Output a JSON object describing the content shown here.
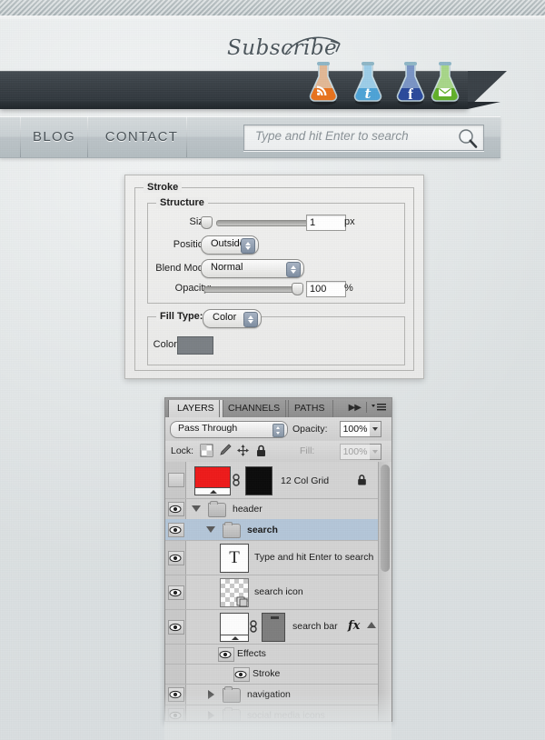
{
  "website": {
    "subscribe_label": "Subscribe",
    "social_icons": [
      {
        "name": "rss-flask-icon",
        "label": "RSS",
        "color": "#e8731e"
      },
      {
        "name": "twitter-flask-icon",
        "label": "Twitter",
        "color": "#4ea3d6"
      },
      {
        "name": "facebook-flask-icon",
        "label": "Facebook",
        "color": "#2b4a9b"
      },
      {
        "name": "email-flask-icon",
        "label": "Email",
        "color": "#62b02a"
      }
    ],
    "nav_items": [
      {
        "label": "BLOG"
      },
      {
        "label": "CONTACT"
      }
    ],
    "search": {
      "placeholder": "Type and hit Enter to search",
      "value": "",
      "icon": "magnifier-icon"
    }
  },
  "stroke_dialog": {
    "group_title": "Stroke",
    "structure": {
      "title": "Structure",
      "size_label": "Size:",
      "size_value": "1",
      "size_unit": "px",
      "position_label": "Position:",
      "position_value": "Outside",
      "blend_label": "Blend Mode:",
      "blend_value": "Normal",
      "opacity_label": "Opacity:",
      "opacity_value": "100",
      "opacity_unit": "%"
    },
    "fill": {
      "fill_type_label": "Fill Type:",
      "fill_type_value": "Color",
      "color_label": "Color:",
      "color_swatch": "#7b8085"
    }
  },
  "layers_panel": {
    "tabs": [
      {
        "label": "LAYERS",
        "active": true
      },
      {
        "label": "CHANNELS",
        "active": false
      },
      {
        "label": "PATHS",
        "active": false
      }
    ],
    "collapse_icon": "double-arrow-icon",
    "menu_icon": "panel-menu-icon",
    "blend_mode": "Pass Through",
    "opacity_label": "Opacity:",
    "opacity_value": "100%",
    "lock_label": "Lock:",
    "lock_icons": [
      "transparency-lock-icon",
      "brush-lock-icon",
      "move-lock-icon",
      "all-lock-icon"
    ],
    "fill_label": "Fill:",
    "fill_value": "100%",
    "rows": [
      {
        "name": "12 Col Grid",
        "type": "layer",
        "visible": false,
        "locked": true,
        "selected": false,
        "indent": 0,
        "dim": false
      },
      {
        "name": "header",
        "type": "group",
        "visible": true,
        "expanded": true,
        "selected": false,
        "indent": 0,
        "dim": false
      },
      {
        "name": "search",
        "type": "group",
        "visible": true,
        "expanded": true,
        "selected": true,
        "indent": 1,
        "dim": false
      },
      {
        "name": "Type and hit Enter to search",
        "type": "text",
        "visible": true,
        "selected": false,
        "indent": 2,
        "dim": false
      },
      {
        "name": "search icon",
        "type": "layer",
        "visible": true,
        "selected": false,
        "indent": 2,
        "dim": false
      },
      {
        "name": "search bar",
        "type": "layer",
        "visible": true,
        "selected": false,
        "indent": 2,
        "dim": false,
        "fx": "fx"
      },
      {
        "name": "Effects",
        "type": "effects",
        "visible": true,
        "selected": false,
        "indent": 3,
        "dim": false
      },
      {
        "name": "Stroke",
        "type": "effect",
        "visible": true,
        "selected": false,
        "indent": 4,
        "dim": false
      },
      {
        "name": "navigation",
        "type": "group",
        "visible": true,
        "expanded": false,
        "selected": false,
        "indent": 1,
        "dim": false
      },
      {
        "name": "social media icons",
        "type": "group",
        "visible": true,
        "expanded": false,
        "selected": false,
        "indent": 1,
        "dim": true
      }
    ]
  }
}
